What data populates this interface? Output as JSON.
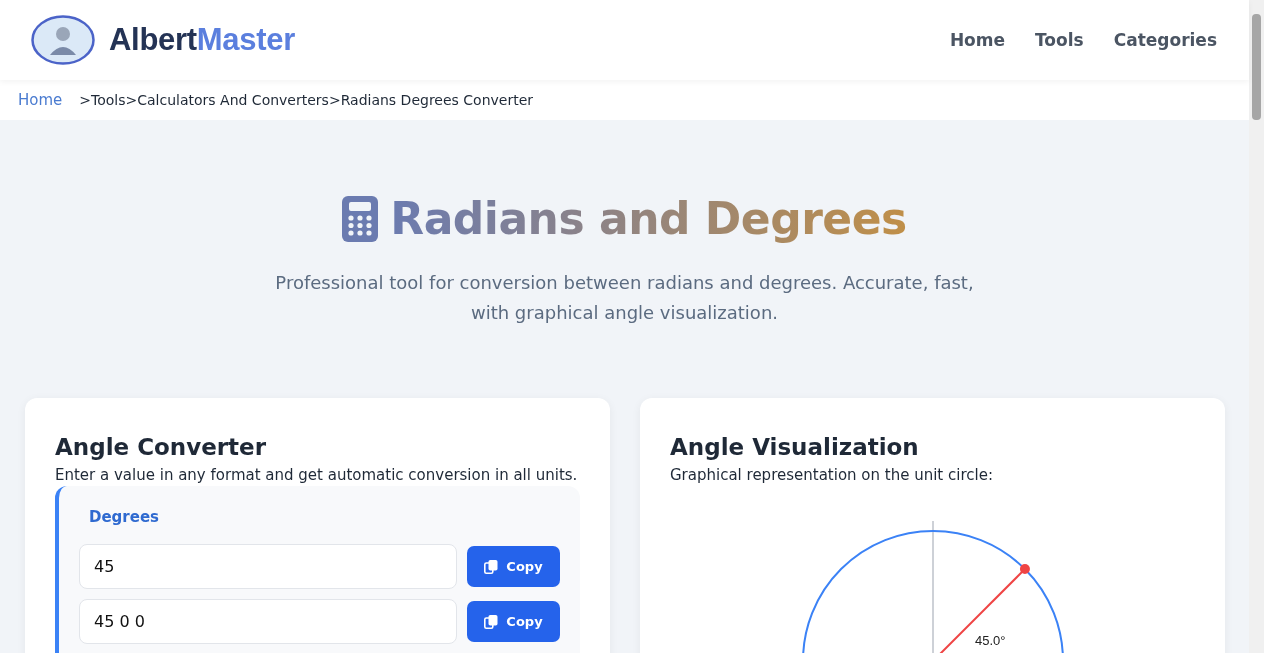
{
  "header": {
    "brand": {
      "first": "Albert",
      "second": "Master"
    },
    "nav": [
      {
        "label": "Home"
      },
      {
        "label": "Tools"
      },
      {
        "label": "Categories"
      }
    ]
  },
  "breadcrumb": {
    "home": "Home",
    "trail": [
      ">Tools",
      ">Calculators And Converters",
      ">Radians Degrees Converter"
    ]
  },
  "hero": {
    "title": "Radians and Degrees",
    "subtitle": "Professional tool for conversion between radians and degrees. Accurate, fast, with graphical angle visualization."
  },
  "converter": {
    "title": "Angle Converter",
    "description": "Enter a value in any format and get automatic conversion in all units.",
    "group_label": "Degrees",
    "fields": [
      {
        "value": "45",
        "button": "Copy"
      },
      {
        "value": "45 0 0",
        "button": "Copy"
      }
    ]
  },
  "visualization": {
    "title": "Angle Visualization",
    "description": "Graphical representation on the unit circle:",
    "angle_label": "45.0°"
  }
}
